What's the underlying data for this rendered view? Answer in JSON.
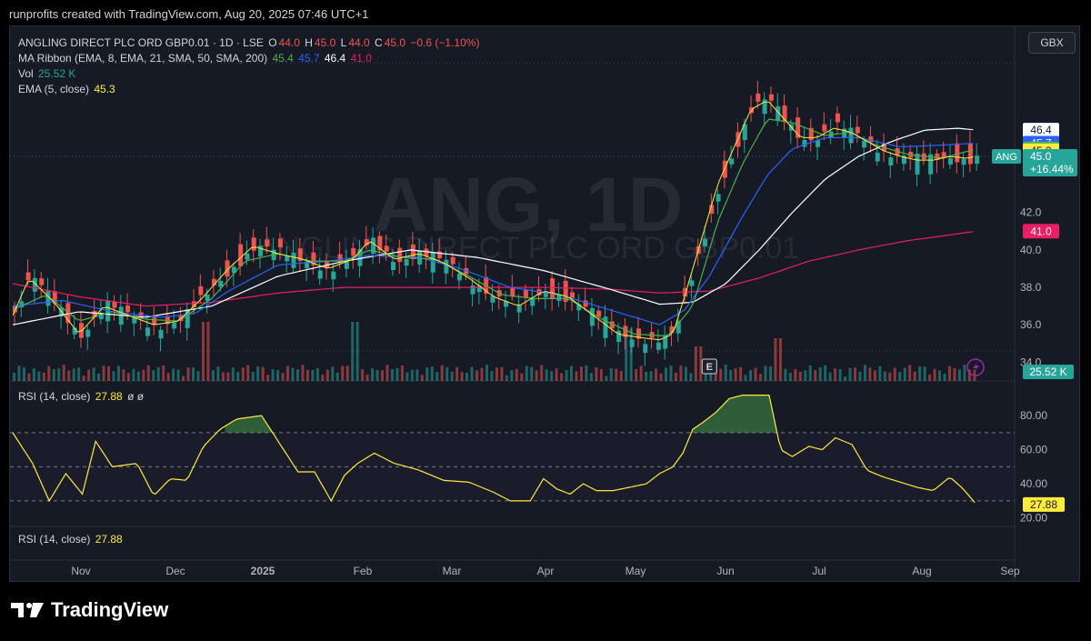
{
  "attribution": "runprofits created with TradingView.com, Aug 20, 2025 07:46 UTC+1",
  "brand": "TradingView",
  "currency_button": "GBX",
  "header": {
    "symbol": "ANGLING DIRECT PLC ORD GBP0.01 · 1D · LSE",
    "o_label": "O",
    "o_value": "44.0",
    "h_label": "H",
    "h_value": "45.0",
    "l_label": "L",
    "l_value": "44.0",
    "c_label": "C",
    "c_value": "45.0",
    "change": "−0.6 (−1.10%)"
  },
  "legend": {
    "ma_ribbon_label": "MA Ribbon (EMA, 8, EMA, 21, SMA, 50, SMA, 200)",
    "ma_values": [
      "45.4",
      "45.7",
      "46.4",
      "41.0"
    ],
    "vol_label": "Vol",
    "vol_value": "25.52 K",
    "ema_label": "EMA (5, close)",
    "ema_value": "45.3",
    "rsi_label": "RSI (14, close)",
    "rsi_value": "27.88",
    "rsi_extra": "ø ø",
    "rsi2_label": "RSI (14, close)",
    "rsi2_value": "27.88"
  },
  "watermark": {
    "symbol": "ANG, 1D",
    "name": "ANGLING DIRECT PLC ORD GBP0.01"
  },
  "price_tags": [
    {
      "text": "46.4",
      "bg": "#ffffff",
      "fg": "#131722",
      "price": 46.4
    },
    {
      "text": "45.7",
      "bg": "#2962ff",
      "fg": "#ffffff",
      "price": 45.7
    },
    {
      "text": "45.4",
      "bg": "#4caf50",
      "fg": "#ffffff",
      "price": 45.4
    },
    {
      "text": "45.3",
      "bg": "#ffeb3b",
      "fg": "#131722",
      "price": 45.3
    },
    {
      "text": "41.0",
      "bg": "#e91e63",
      "fg": "#ffffff",
      "price": 41.0
    }
  ],
  "last_price": {
    "symbol_tag": "ANG",
    "price": "45.0",
    "change": "+16.44%",
    "color": "#26a69a"
  },
  "volume_tag": "25.52 K",
  "rsi_tag": "27.88",
  "earnings_marker": "E",
  "colors": {
    "up": "#26a69a",
    "down": "#ef5350",
    "ema8": "#4caf50",
    "ema21": "#2962ff",
    "sma50": "#ffffff",
    "sma200": "#e91e63",
    "ema5": "#ffeb3b",
    "rsi": "#ffeb3b"
  },
  "chart_data": {
    "type": "candlestick",
    "title": "ANGLING DIRECT PLC ORD GBP0.01 · 1D · LSE",
    "y_ticks": [
      34.0,
      36.0,
      38.0,
      40.0,
      42.0
    ],
    "x_ticks": [
      "Nov",
      "Dec",
      "2025",
      "Feb",
      "Mar",
      "Apr",
      "May",
      "Jun",
      "Jul",
      "Aug",
      "Sep"
    ],
    "rsi_ticks": [
      20.0,
      40.0,
      60.0,
      80.0
    ],
    "rsi_levels": [
      30,
      50,
      70
    ],
    "price_path": [
      [
        0,
        36.5
      ],
      [
        10,
        38.5
      ],
      [
        25,
        37.2
      ],
      [
        40,
        35.5
      ],
      [
        55,
        37.0
      ],
      [
        70,
        36.5
      ],
      [
        85,
        36.0
      ],
      [
        100,
        36.2
      ],
      [
        115,
        37.5
      ],
      [
        130,
        39.0
      ],
      [
        145,
        40.2
      ],
      [
        160,
        39.8
      ],
      [
        175,
        39.5
      ],
      [
        190,
        39.0
      ],
      [
        205,
        39.5
      ],
      [
        215,
        40.5
      ],
      [
        230,
        39.5
      ],
      [
        245,
        39.8
      ],
      [
        260,
        39.3
      ],
      [
        275,
        38.5
      ],
      [
        290,
        37.5
      ],
      [
        305,
        37.0
      ],
      [
        320,
        37.8
      ],
      [
        335,
        37.5
      ],
      [
        350,
        36.5
      ],
      [
        365,
        35.5
      ],
      [
        380,
        35.3
      ],
      [
        390,
        35.2
      ],
      [
        398,
        35.5
      ],
      [
        405,
        37.5
      ],
      [
        415,
        40.5
      ],
      [
        425,
        43.5
      ],
      [
        435,
        45.5
      ],
      [
        445,
        47.5
      ],
      [
        455,
        48.0
      ],
      [
        465,
        47.0
      ],
      [
        475,
        46.0
      ],
      [
        485,
        46.0
      ],
      [
        495,
        46.5
      ],
      [
        505,
        46.3
      ],
      [
        515,
        45.8
      ],
      [
        525,
        45.3
      ],
      [
        535,
        45.0
      ],
      [
        545,
        44.8
      ],
      [
        555,
        44.8
      ],
      [
        565,
        45.0
      ],
      [
        575,
        44.9
      ],
      [
        581,
        45.0
      ]
    ],
    "ema8": [
      [
        0,
        36.8
      ],
      [
        20,
        37.6
      ],
      [
        40,
        36.2
      ],
      [
        60,
        36.7
      ],
      [
        80,
        36.3
      ],
      [
        100,
        36.2
      ],
      [
        120,
        37.4
      ],
      [
        140,
        39.4
      ],
      [
        160,
        39.8
      ],
      [
        180,
        39.4
      ],
      [
        200,
        39.4
      ],
      [
        215,
        40.0
      ],
      [
        235,
        39.6
      ],
      [
        255,
        39.5
      ],
      [
        275,
        38.6
      ],
      [
        295,
        37.6
      ],
      [
        315,
        37.4
      ],
      [
        335,
        37.4
      ],
      [
        355,
        36.3
      ],
      [
        375,
        35.5
      ],
      [
        395,
        35.4
      ],
      [
        410,
        37.0
      ],
      [
        425,
        41.5
      ],
      [
        440,
        44.6
      ],
      [
        455,
        47.0
      ],
      [
        470,
        46.8
      ],
      [
        490,
        46.1
      ],
      [
        505,
        46.3
      ],
      [
        520,
        45.6
      ],
      [
        540,
        45.1
      ],
      [
        560,
        44.9
      ],
      [
        581,
        45.4
      ]
    ],
    "ema21": [
      [
        0,
        37.0
      ],
      [
        30,
        37.3
      ],
      [
        60,
        36.7
      ],
      [
        90,
        36.4
      ],
      [
        110,
        36.6
      ],
      [
        130,
        37.8
      ],
      [
        160,
        39.2
      ],
      [
        190,
        39.4
      ],
      [
        215,
        39.7
      ],
      [
        245,
        39.6
      ],
      [
        270,
        39.0
      ],
      [
        300,
        38.0
      ],
      [
        330,
        37.6
      ],
      [
        360,
        36.8
      ],
      [
        390,
        36.0
      ],
      [
        405,
        36.8
      ],
      [
        420,
        38.6
      ],
      [
        440,
        41.8
      ],
      [
        455,
        44.0
      ],
      [
        470,
        45.4
      ],
      [
        490,
        46.0
      ],
      [
        510,
        46.0
      ],
      [
        535,
        45.5
      ],
      [
        560,
        45.6
      ],
      [
        581,
        45.7
      ]
    ],
    "sma50": [
      [
        0,
        36.0
      ],
      [
        40,
        36.7
      ],
      [
        80,
        36.4
      ],
      [
        120,
        37.0
      ],
      [
        160,
        38.6
      ],
      [
        200,
        39.4
      ],
      [
        240,
        40.0
      ],
      [
        280,
        39.6
      ],
      [
        320,
        38.9
      ],
      [
        360,
        37.9
      ],
      [
        390,
        37.1
      ],
      [
        410,
        37.2
      ],
      [
        430,
        38.2
      ],
      [
        450,
        40.0
      ],
      [
        470,
        42.0
      ],
      [
        490,
        43.8
      ],
      [
        510,
        45.0
      ],
      [
        530,
        45.8
      ],
      [
        550,
        46.4
      ],
      [
        570,
        46.5
      ],
      [
        581,
        46.4
      ]
    ],
    "sma200": [
      [
        0,
        38.2
      ],
      [
        40,
        37.5
      ],
      [
        80,
        37.0
      ],
      [
        120,
        37.2
      ],
      [
        160,
        37.7
      ],
      [
        200,
        38.0
      ],
      [
        240,
        38.0
      ],
      [
        280,
        38.0
      ],
      [
        320,
        38.0
      ],
      [
        360,
        37.9
      ],
      [
        390,
        37.7
      ],
      [
        420,
        37.8
      ],
      [
        450,
        38.5
      ],
      [
        480,
        39.4
      ],
      [
        510,
        40.0
      ],
      [
        540,
        40.5
      ],
      [
        581,
        41.0
      ]
    ],
    "rsi": [
      [
        0,
        70
      ],
      [
        12,
        52
      ],
      [
        22,
        30
      ],
      [
        32,
        46
      ],
      [
        42,
        34
      ],
      [
        50,
        65
      ],
      [
        60,
        50
      ],
      [
        75,
        52
      ],
      [
        85,
        33
      ],
      [
        95,
        43
      ],
      [
        105,
        42
      ],
      [
        115,
        62
      ],
      [
        125,
        72
      ],
      [
        135,
        78
      ],
      [
        150,
        80
      ],
      [
        162,
        62
      ],
      [
        172,
        47
      ],
      [
        182,
        47
      ],
      [
        192,
        30
      ],
      [
        200,
        45
      ],
      [
        208,
        52
      ],
      [
        218,
        58
      ],
      [
        230,
        52
      ],
      [
        245,
        48
      ],
      [
        260,
        42
      ],
      [
        275,
        41
      ],
      [
        290,
        35
      ],
      [
        300,
        30
      ],
      [
        312,
        30
      ],
      [
        320,
        43
      ],
      [
        328,
        37
      ],
      [
        336,
        34
      ],
      [
        344,
        40
      ],
      [
        352,
        36
      ],
      [
        362,
        36
      ],
      [
        372,
        38
      ],
      [
        382,
        40
      ],
      [
        390,
        46
      ],
      [
        398,
        50
      ],
      [
        404,
        58
      ],
      [
        410,
        72
      ],
      [
        416,
        76
      ],
      [
        424,
        82
      ],
      [
        432,
        90
      ],
      [
        440,
        92
      ],
      [
        448,
        92
      ],
      [
        456,
        92
      ],
      [
        463,
        60
      ],
      [
        470,
        56
      ],
      [
        480,
        62
      ],
      [
        488,
        60
      ],
      [
        496,
        67
      ],
      [
        506,
        63
      ],
      [
        515,
        48
      ],
      [
        525,
        44
      ],
      [
        535,
        41
      ],
      [
        545,
        38
      ],
      [
        555,
        36
      ],
      [
        565,
        44
      ],
      [
        573,
        37
      ],
      [
        581,
        27.88
      ]
    ],
    "volume_spikes": [
      [
        115,
        1.0
      ],
      [
        205,
        1.0
      ],
      [
        370,
        0.85
      ],
      [
        412,
        0.4
      ],
      [
        460,
        0.6
      ]
    ]
  }
}
